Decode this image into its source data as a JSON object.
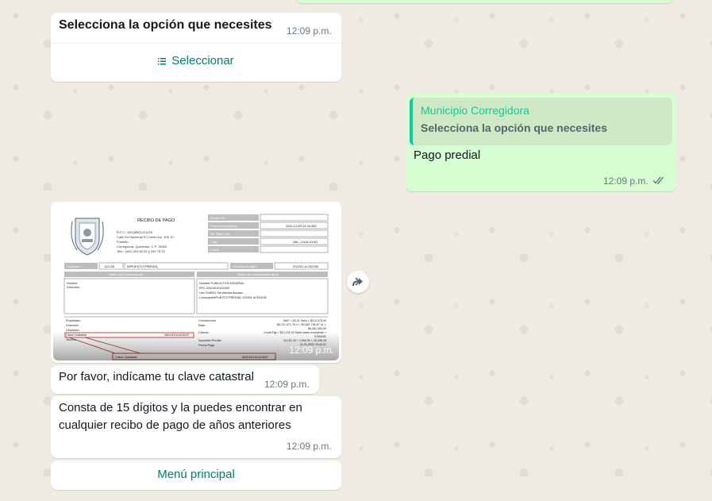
{
  "messages": {
    "list_message": {
      "title": "Selecciona la opción que necesites",
      "time": "12:09 p.m.",
      "select_label": "Seleccionar",
      "select_icon": "list-icon"
    },
    "reply": {
      "quoted_author": "Municipio Corregidora",
      "quoted_text": "Selecciona la opción que necesites",
      "text": "Pago predial",
      "time": "12:09 p.m.",
      "status_icon": "double-check-icon"
    },
    "receipt_image": {
      "time": "12:09 p.m.",
      "header_title": "RECIBO DE PAGO",
      "issuer_lines": [
        "R.F.C.- MCQ8501011JX0",
        "Calle Ex Hacienda El Cerrito No. 100, El",
        "Pueblito,",
        "Corregidora, Querétaro, C.P. 76900",
        "Tels.: (442) 209 60 52 y 209 75 13"
      ],
      "fields": [
        {
          "label": "Recibo No.",
          "value": ""
        },
        {
          "label": "Fecha Hora Emisión",
          "value": "2022-12-09T11:44:28Z"
        },
        {
          "label": "No. Pase Caja",
          "value": ""
        },
        {
          "label": "Caja",
          "value": "198 - CAJA OXXO"
        },
        {
          "label": "Cajero",
          "value": ""
        }
      ],
      "concept_label": "Concepto",
      "concept_code": "112130",
      "concept_name": "IMPUESTO PREDIAL",
      "period_label": "Período de pago",
      "period_value": "202201 al 202206",
      "taxpayer_header": "Datos del Contribuyente",
      "fiscal_header": "Datos del comprobante fiscal",
      "taxpayer_fields": [
        "Nombre",
        "Dirección:"
      ],
      "fiscal_lines": [
        "Nombre PUBLICO EN GENERAL",
        "RFC XAXX010101000",
        "Uso CfdiS01 Sin efectos fiscales.",
        "ConceptoIMPUESTO PREDIAL 202201 al 202206"
      ],
      "property_fields": [
        "Propietario",
        "Dirección",
        "Ubicación",
        "Clave Catastral",
        "Terreno"
      ],
      "property_key_value": "060100101023037",
      "calc_labels": [
        "Construcción",
        "Base",
        "Cálculo",
        "Impuesto Predial",
        "Fecha Pago"
      ],
      "calc_values": [
        "M&F = 63.21 Valor = $214,475.49",
        "$6,121,471.75 U = $4,587,796.67 VL =",
        "$6,282,950.53",
        "Couta Fija = $10,151.33 Tarifa sobre excedente =",
        "0.004341",
        "10,151.33 + 7,004.90 = 25,156.28",
        "11-01-2022 15:42:37"
      ],
      "bottom_key_label": "Clave Catastral",
      "bottom_key_value": "060100101023037"
    },
    "clave_request": {
      "text": "Por favor, indícame tu clave catastral",
      "time": "12:09 p.m."
    },
    "clave_info": {
      "line1": "Consta de 15 dígitos y la puedes encontrar en",
      "line2": "cualquier recibo de pago de años anteriores",
      "time": "12:09 p.m.",
      "button_label": "Menú principal"
    }
  },
  "icons": {
    "forward": "forward-icon",
    "seal": "municipal-seal-icon"
  },
  "colors": {
    "background": "#efeae2",
    "incoming_bubble": "#ffffff",
    "outgoing_bubble": "#d9fdd3",
    "accent": "#008069",
    "quote_accent": "#06cf9c",
    "meta_text": "#667781"
  }
}
